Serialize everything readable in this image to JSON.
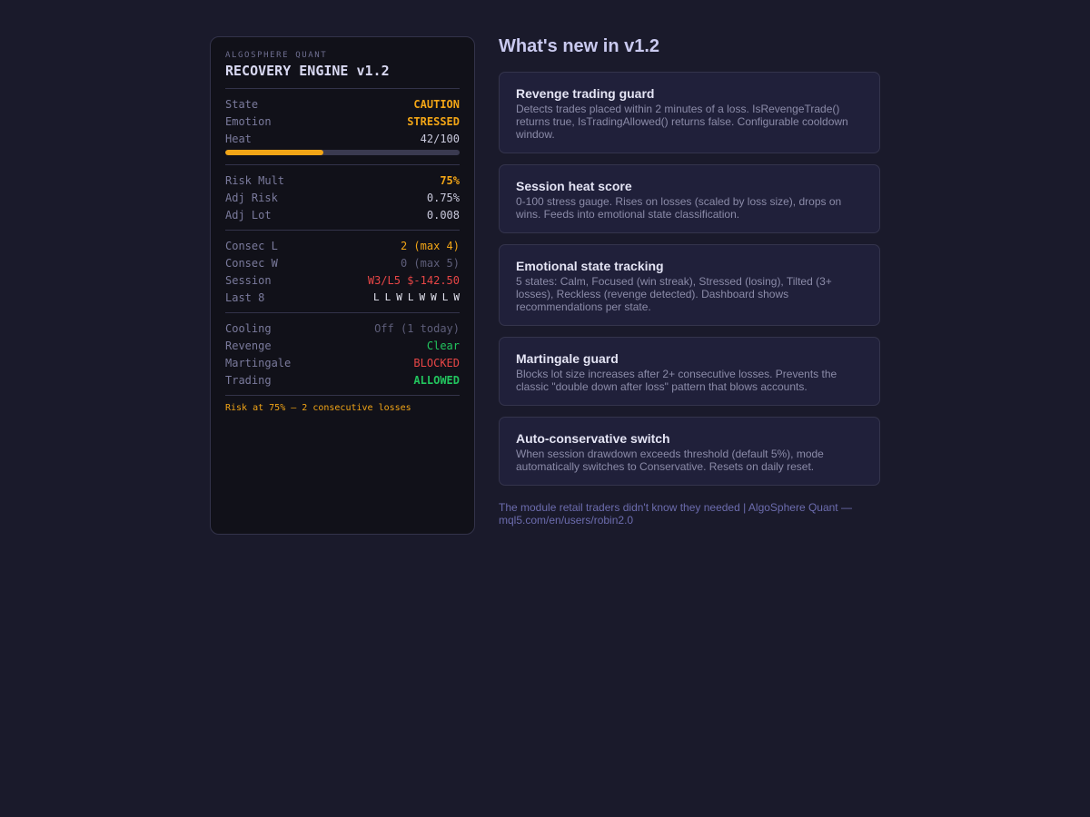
{
  "panel": {
    "brand": "ALGOSPHERE QUANT",
    "title": "RECOVERY ENGINE v1.2",
    "state": {
      "label": "State",
      "value": "CAUTION"
    },
    "emotion": {
      "label": "Emotion",
      "value": "STRESSED"
    },
    "heat": {
      "label": "Heat",
      "value": "42/100",
      "fraction": 0.42
    },
    "risk_mult": {
      "label": "Risk Mult",
      "value": "75%"
    },
    "adj_risk": {
      "label": "Adj Risk",
      "value": "0.75%"
    },
    "adj_lot": {
      "label": "Adj Lot",
      "value": "0.008"
    },
    "consec_l": {
      "label": "Consec L",
      "value": "2 (max 4)"
    },
    "consec_w": {
      "label": "Consec W",
      "value": "0 (max 5)"
    },
    "session": {
      "label": "Session",
      "value": "W3/L5 $-142.50"
    },
    "last8": {
      "label": "Last 8",
      "results": [
        "L",
        "L",
        "W",
        "L",
        "W",
        "W",
        "L",
        "W"
      ]
    },
    "cooling": {
      "label": "Cooling",
      "value": "Off (1 today)"
    },
    "revenge": {
      "label": "Revenge",
      "value": "Clear"
    },
    "martingale": {
      "label": "Martingale",
      "value": "BLOCKED"
    },
    "trading": {
      "label": "Trading",
      "value": "ALLOWED"
    },
    "footnote": "Risk at 75% — 2 consecutive losses"
  },
  "release": {
    "heading": "What's new in v1.2",
    "cards": [
      {
        "title": "Revenge trading guard",
        "desc": "Detects trades placed within 2 minutes of a loss. IsRevengeTrade() returns true, IsTradingAllowed() returns false. Configurable cooldown window."
      },
      {
        "title": "Session heat score",
        "desc": "0-100 stress gauge. Rises on losses (scaled by loss size), drops on wins. Feeds into emotional state classification."
      },
      {
        "title": "Emotional state tracking",
        "desc": "5 states: Calm, Focused (win streak), Stressed (losing), Tilted (3+ losses), Reckless (revenge detected). Dashboard shows recommendations per state."
      },
      {
        "title": "Martingale guard",
        "desc": "Blocks lot size increases after 2+ consecutive losses. Prevents the classic \"double down after loss\" pattern that blows accounts."
      },
      {
        "title": "Auto-conservative switch",
        "desc": "When session drawdown exceeds threshold (default 5%), mode automatically switches to Conservative. Resets on daily reset."
      }
    ],
    "credit": "The module retail traders didn't know they needed | AlgoSphere Quant — mql5.com/en/users/robin2.0"
  },
  "colors": {
    "background": "#1a1a2b",
    "panel": "#111119",
    "caution": "#f2a516",
    "danger": "#e84646",
    "ok": "#22c55e"
  }
}
